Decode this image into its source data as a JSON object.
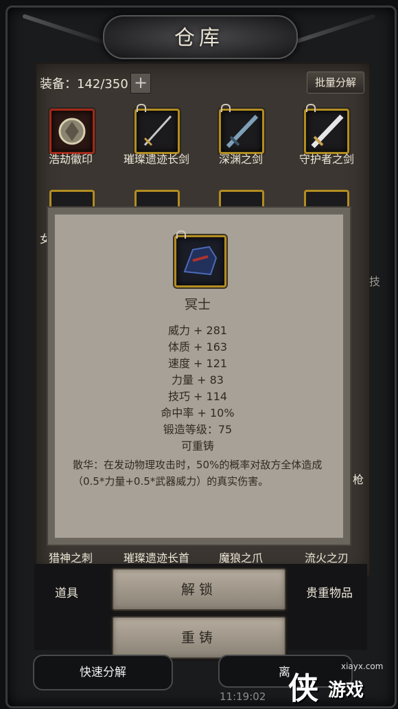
{
  "window": {
    "title": "仓库"
  },
  "capacity": {
    "label": "装备：142/350",
    "add_symbol": "+"
  },
  "toolbar": {
    "bulk_decompose": "批量分解"
  },
  "grid": {
    "row1": [
      {
        "label": "浩劫徽印",
        "frame": "red",
        "icon": "emblem-icon"
      },
      {
        "label": "璀璨遗迹长剑",
        "frame": "gold",
        "icon": "longsword-icon"
      },
      {
        "label": "深渊之剑",
        "frame": "gold",
        "icon": "abyss-sword-icon"
      },
      {
        "label": "守护者之剑",
        "frame": "gold",
        "icon": "guardian-sword-icon"
      }
    ],
    "row2_partial_left": "女",
    "side_fragments": [
      "技",
      "枪"
    ],
    "row_bottom": [
      "猎神之刺",
      "璀璨遗迹长首",
      "魔狼之爪",
      "流火之刃"
    ]
  },
  "tooltip": {
    "item_name": "冥士",
    "item_icon": "gauntlet-icon",
    "stats": [
      "威力 + 281",
      "体质 + 163",
      "速度 + 121",
      "力量 + 83",
      "技巧 + 114",
      "命中率 + 10%",
      "锻造等级：75",
      "可重铸"
    ],
    "description": "散华：在发动物理攻击时，50%的概率对敌方全体造成（0.5*力量+0.5*武器威力）的真实伤害。"
  },
  "tabs": {
    "items": "道具",
    "valuables": "贵重物品"
  },
  "actions": {
    "unlock": "解锁",
    "reforge": "重铸",
    "quick_decompose": "快速分解",
    "leave": "离"
  },
  "status": {
    "clock": "11:19:02"
  },
  "watermark": {
    "logo": "侠",
    "text": "游戏",
    "url": "xiayx.com"
  },
  "colors": {
    "gold_frame": "#b38d20",
    "red_frame": "#a52818",
    "card_bg": "#a8a197"
  }
}
